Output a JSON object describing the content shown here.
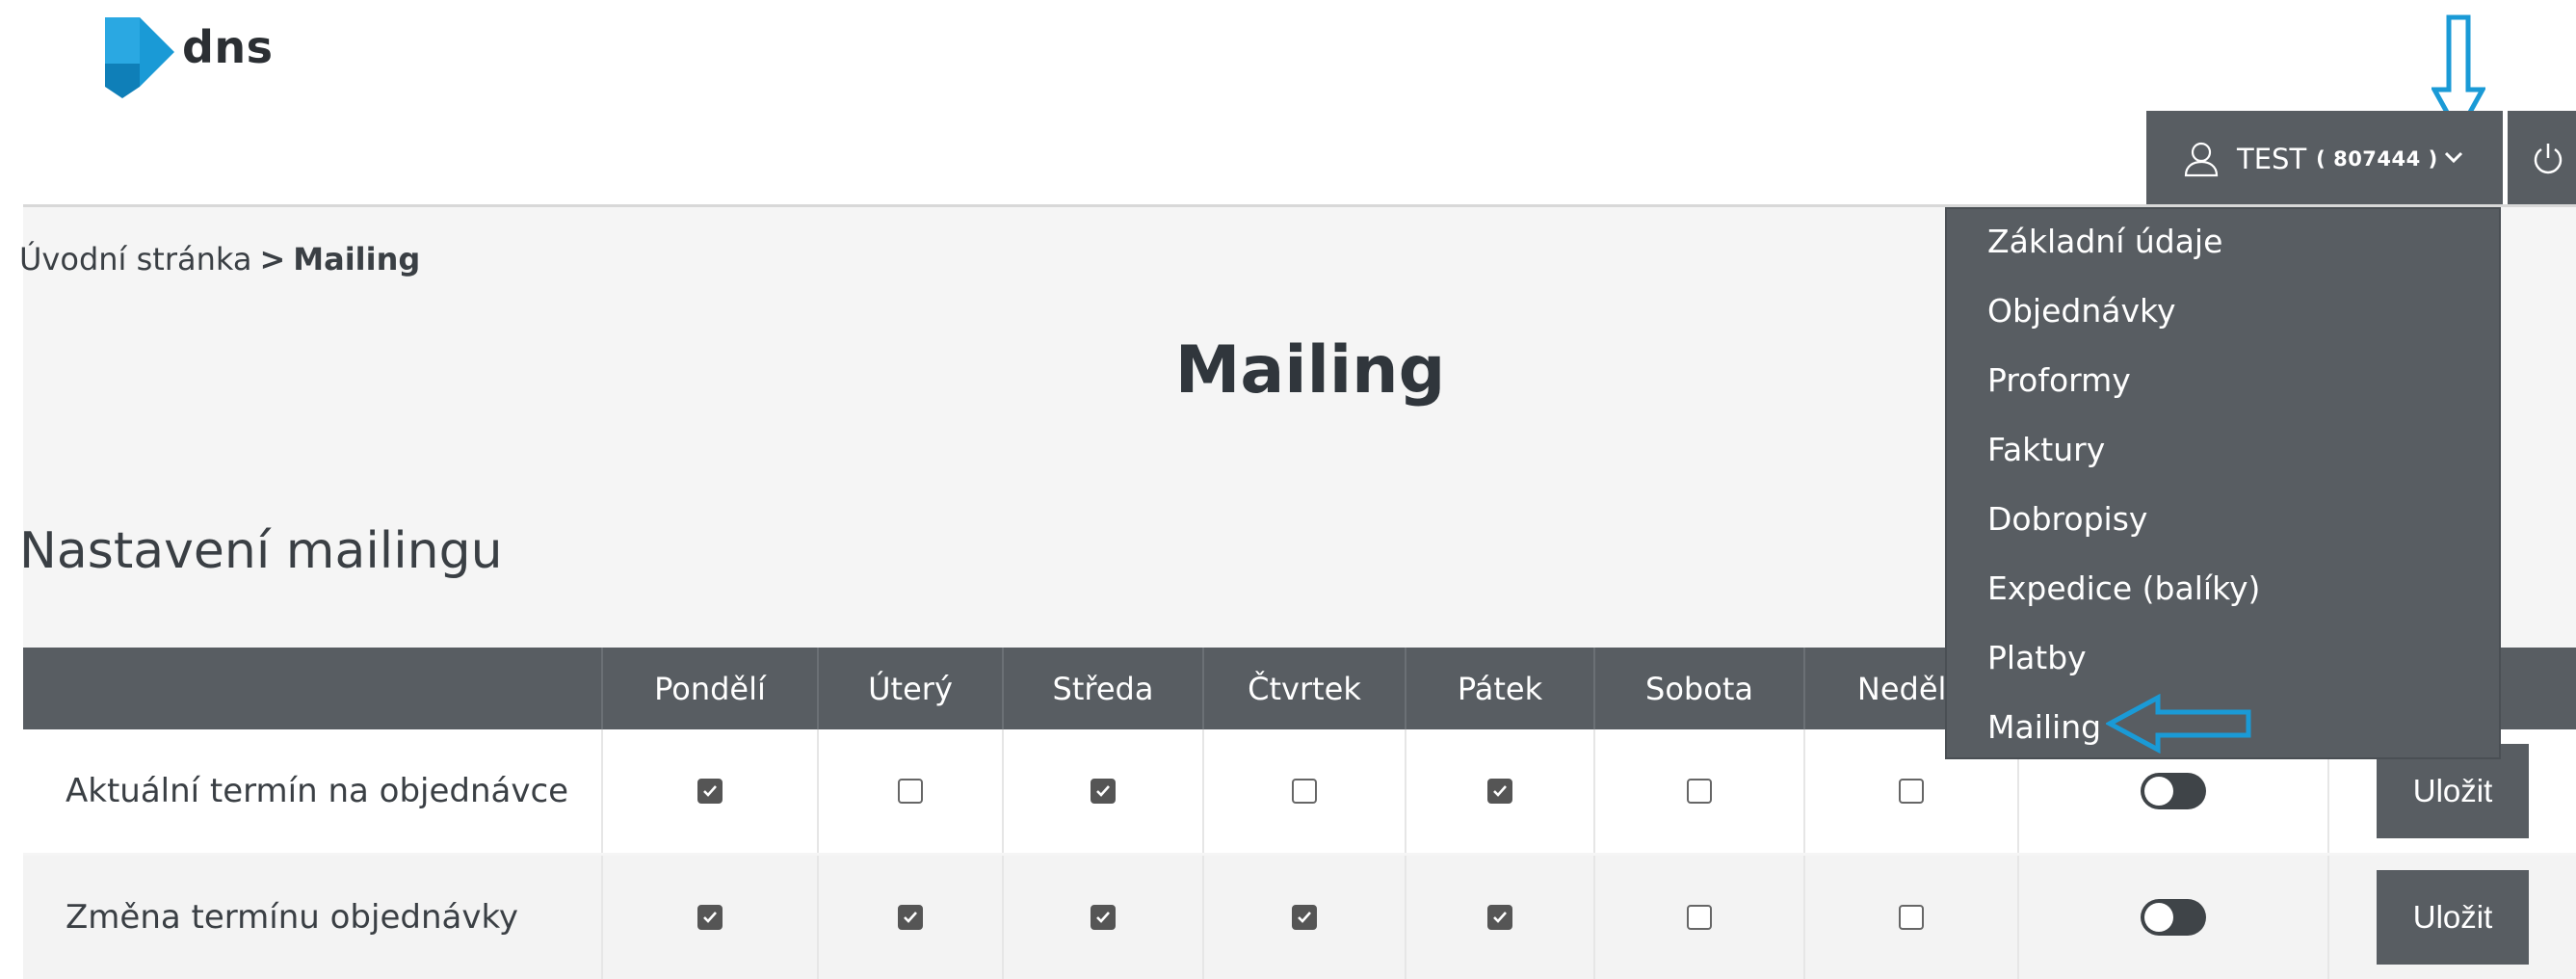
{
  "brand": {
    "name": "dns"
  },
  "user": {
    "name": "TEST",
    "id": "( 807444 )"
  },
  "breadcrumb": {
    "home": "Úvodní stránka",
    "separator": ">",
    "current": "Mailing"
  },
  "page_title": "Mailing",
  "section_title": "Nastavení mailingu",
  "table": {
    "columns": [
      "Pondělí",
      "Úterý",
      "Středa",
      "Čtvrtek",
      "Pátek",
      "Sobota",
      "Neděle"
    ],
    "rows": [
      {
        "label": "Aktuální termín na objednávce",
        "checked": [
          true,
          false,
          true,
          false,
          true,
          false,
          false
        ],
        "toggle": "off",
        "save": "Uložit"
      },
      {
        "label": "Změna termínu objednávky",
        "checked": [
          true,
          true,
          true,
          true,
          true,
          false,
          false
        ],
        "toggle": "off",
        "save": "Uložit"
      }
    ]
  },
  "dropdown": {
    "items": [
      "Základní údaje",
      "Objednávky",
      "Proformy",
      "Faktury",
      "Dobropisy",
      "Expedice (balíky)",
      "Platby",
      "Mailing"
    ]
  },
  "colors": {
    "header_dark": "#585d62",
    "annotation_arrow": "#1a9ad6",
    "logo_blue": "#1a9ad6"
  },
  "icons": [
    "user-icon",
    "chevron-down-icon",
    "power-icon",
    "check-icon"
  ]
}
